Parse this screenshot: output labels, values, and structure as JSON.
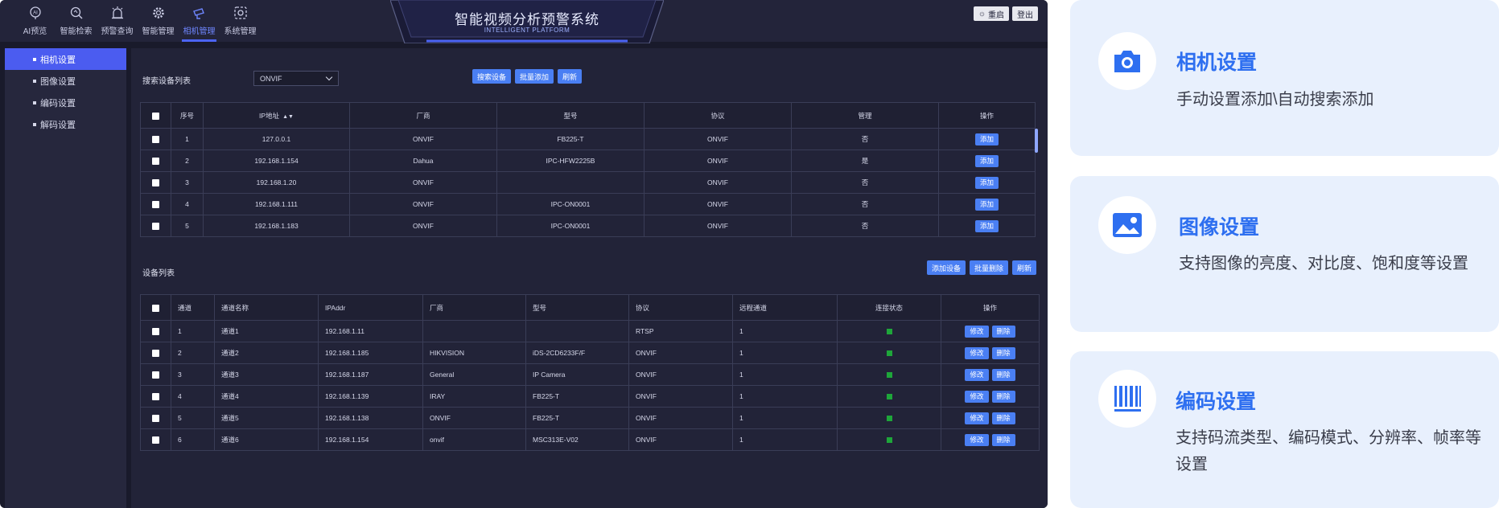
{
  "nav": [
    {
      "label": "AI预览",
      "icon": "ai-brain-icon"
    },
    {
      "label": "智能检索",
      "icon": "search-icon"
    },
    {
      "label": "预警查询",
      "icon": "alarm-icon"
    },
    {
      "label": "智能管理",
      "icon": "gear-icon"
    },
    {
      "label": "相机管理",
      "icon": "camera-icon"
    },
    {
      "label": "系统管理",
      "icon": "system-settings-icon"
    }
  ],
  "header": {
    "title": "智能视频分析预警系统",
    "subtitle": "INTELLIGENT PLATFORM"
  },
  "top_actions": {
    "restart": "重启",
    "logout": "登出"
  },
  "sidebar": {
    "items": [
      "相机设置",
      "图像设置",
      "编码设置",
      "解码设置"
    ]
  },
  "search_section": {
    "label": "搜索设备列表",
    "protocol_select": "ONVIF",
    "buttons": [
      "搜索设备",
      "批量添加",
      "刷新"
    ],
    "headers": [
      "序号",
      "IP地址",
      "厂商",
      "型号",
      "协议",
      "管理",
      "操作"
    ],
    "action_label": "添加",
    "rows": [
      [
        "1",
        "127.0.0.1",
        "ONVIF",
        "FB225-T",
        "ONVIF",
        "否"
      ],
      [
        "2",
        "192.168.1.154",
        "Dahua",
        "IPC-HFW2225B",
        "ONVIF",
        "是"
      ],
      [
        "3",
        "192.168.1.20",
        "ONVIF",
        "",
        "ONVIF",
        "否"
      ],
      [
        "4",
        "192.168.1.111",
        "ONVIF",
        "IPC-ON0001",
        "ONVIF",
        "否"
      ],
      [
        "5",
        "192.168.1.183",
        "ONVIF",
        "IPC-ON0001",
        "ONVIF",
        "否"
      ]
    ]
  },
  "device_section": {
    "label": "设备列表",
    "buttons": [
      "添加设备",
      "批量删除",
      "刷新"
    ],
    "headers": [
      "通道",
      "通道名称",
      "IPAddr",
      "厂商",
      "型号",
      "协议",
      "远程通道",
      "连接状态",
      "操作"
    ],
    "edit_label": "修改",
    "delete_label": "删除",
    "status_color": "#1ea63a",
    "rows": [
      [
        "1",
        "通道1",
        "192.168.1.11",
        "",
        "",
        "RTSP",
        "1"
      ],
      [
        "2",
        "通道2",
        "192.168.1.185",
        "HIKVISION",
        "iDS-2CD6233F/F",
        "ONVIF",
        "1"
      ],
      [
        "3",
        "通道3",
        "192.168.1.187",
        "General",
        "IP Camera",
        "ONVIF",
        "1"
      ],
      [
        "4",
        "通道4",
        "192.168.1.139",
        "IRAY",
        "FB225-T",
        "ONVIF",
        "1"
      ],
      [
        "5",
        "通道5",
        "192.168.1.138",
        "ONVIF",
        "FB225-T",
        "ONVIF",
        "1"
      ],
      [
        "6",
        "通道6",
        "192.168.1.154",
        "onvif",
        "MSC313E-V02",
        "ONVIF",
        "1"
      ]
    ]
  },
  "cards": [
    {
      "title": "相机设置",
      "desc": "手动设置添加\\自动搜索添加",
      "icon": "camera-icon"
    },
    {
      "title": "图像设置",
      "desc": "支持图像的亮度、对比度、饱和度等设置",
      "icon": "image-icon"
    },
    {
      "title": "编码设置",
      "desc": "支持码流类型、编码模式、分辨率、帧率等设置",
      "icon": "barcode-icon"
    }
  ],
  "colors": {
    "accent": "#4b5cf0",
    "button": "#4a7ff3",
    "card_title": "#2e6ff0",
    "card_bg": "#e8f0fd"
  }
}
